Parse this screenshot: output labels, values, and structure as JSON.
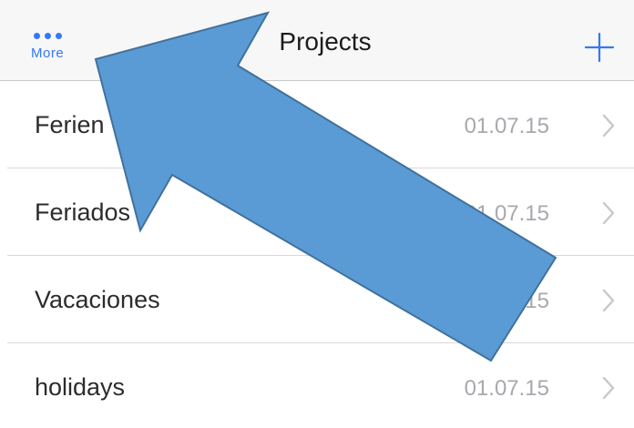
{
  "navbar": {
    "more_label": "More",
    "title": "Projects",
    "more_icon": "ellipsis-icon",
    "add_icon": "plus-icon"
  },
  "projects": [
    {
      "name": "Ferien",
      "date": "01.07.15"
    },
    {
      "name": "Feriados",
      "date": "01.07.15"
    },
    {
      "name": "Vacaciones",
      "date": "01.07.15"
    },
    {
      "name": "holidays",
      "date": "01.07.15"
    }
  ],
  "colors": {
    "accent": "#3478f6",
    "navbar_bg": "#f7f7f7",
    "date_text": "#a8a8ad",
    "arrow_fill": "#5b9bd5",
    "arrow_stroke": "#41719c"
  }
}
